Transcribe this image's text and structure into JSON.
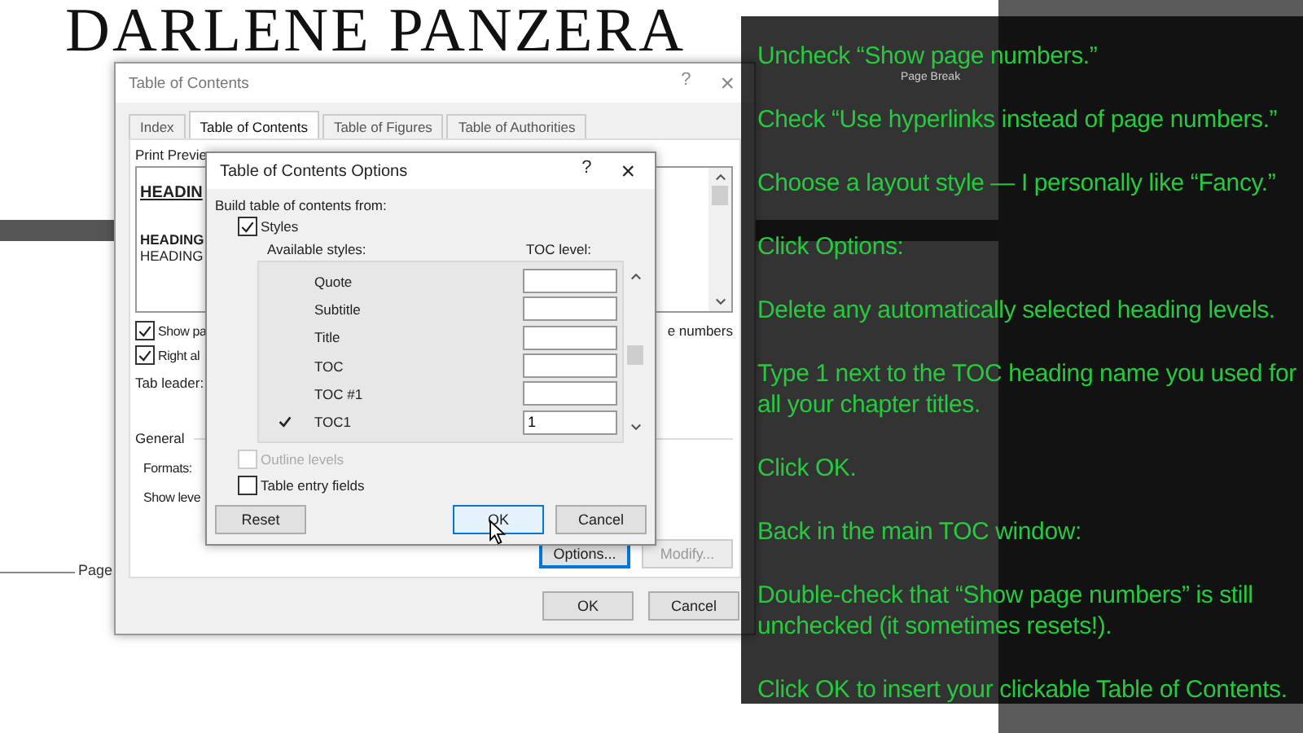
{
  "page": {
    "header": "DARLENE PANZERA",
    "page_break_left": "Page",
    "page_break_label": "Page Break"
  },
  "toc_dialog": {
    "title": "Table of Contents",
    "help": "?",
    "close": "×",
    "tabs": [
      {
        "label": "Index",
        "selected": false
      },
      {
        "label": "Table of Contents",
        "selected": true
      },
      {
        "label": "Table of Figures",
        "selected": false
      },
      {
        "label": "Table of Authorities",
        "selected": false
      }
    ],
    "preview_label": "Print Previe",
    "preview_lines": [
      {
        "text": "HEADIN",
        "kind": "h1"
      },
      {
        "text": "HEADING",
        "kind": "h2"
      },
      {
        "text": "HEADING",
        "kind": "h3"
      }
    ],
    "checkboxes": [
      {
        "label": "Show pa",
        "checked": true
      },
      {
        "label": "Right al",
        "checked": true
      }
    ],
    "right_option_fragment": "e numbers",
    "tab_leader_label": "Tab leader:",
    "general_label": "General",
    "formats_label": "Formats:",
    "show_levels_label": "Show leve",
    "buttons": [
      {
        "label": "Options...",
        "disabled": false,
        "focused": true
      },
      {
        "label": "Modify...",
        "disabled": true,
        "focused": false
      }
    ],
    "footer_buttons": [
      {
        "label": "OK"
      },
      {
        "label": "Cancel"
      }
    ]
  },
  "options_dialog": {
    "title": "Table of Contents Options",
    "help": "?",
    "close": "×",
    "build_label": "Build table of contents from:",
    "styles": {
      "label": "Styles",
      "checked": true
    },
    "available_styles_label": "Available styles:",
    "toc_level_label": "TOC level:",
    "styles_list": [
      {
        "name": "Quote",
        "in_use": false
      },
      {
        "name": "Subtitle",
        "in_use": false
      },
      {
        "name": "Title",
        "in_use": false
      },
      {
        "name": "TOC",
        "in_use": false
      },
      {
        "name": "TOC #1",
        "in_use": false
      },
      {
        "name": "TOC1",
        "in_use": true,
        "toc_level": "1"
      }
    ],
    "options": [
      {
        "label": "Outline levels",
        "checked": false,
        "disabled": true
      },
      {
        "label": "Table entry fields",
        "checked": false,
        "disabled": false
      }
    ],
    "buttons": [
      {
        "label": "Reset",
        "focused": false
      },
      {
        "label": "OK",
        "focused": true
      },
      {
        "label": "Cancel",
        "focused": false
      }
    ]
  },
  "instructions": [
    {
      "text": "Uncheck “Show page numbers.”"
    },
    {
      "text": "Check “Use hyperlinks instead of page numbers.”"
    },
    {
      "text": "Choose a layout style — I personally like “Fancy.”"
    },
    {
      "text": "Click Options:"
    },
    {
      "text": "Delete any automatically selected heading levels."
    },
    {
      "text": "Type 1 next to the TOC heading name you used for all your chapter titles."
    },
    {
      "text": "Click OK."
    },
    {
      "text": "Back in the main TOC window:"
    },
    {
      "text": "Double-check that “Show page numbers” is still unchecked (it sometimes resets!)."
    },
    {
      "text": "Click OK to insert your clickable Table of Contents."
    }
  ]
}
